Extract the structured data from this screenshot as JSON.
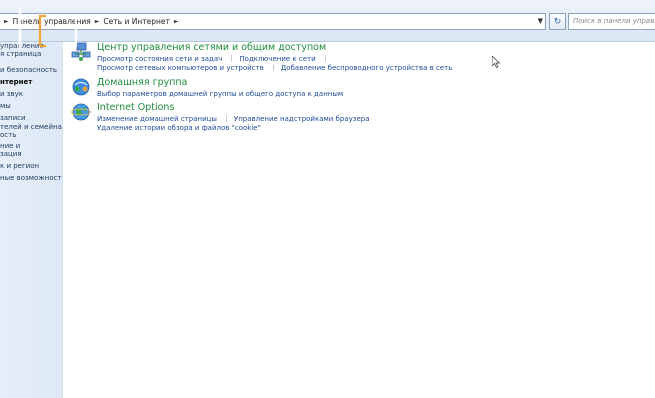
{
  "address": {
    "crumbs": [
      "Панель управления",
      "Сеть и Интернет"
    ],
    "search_placeholder": "Поиск в панели управления"
  },
  "leftpane": {
    "items": [
      "управления",
      "я страница",
      "и безопасность",
      "нтернет",
      "и звук",
      "мы",
      "записи",
      "телей и семейная",
      "ость",
      "ние и",
      "зация",
      "к и регион",
      "ные возможности"
    ]
  },
  "categories": [
    {
      "title": "Центр управления сетями и общим доступом",
      "rows": [
        [
          "Просмотр состояния сети и задач",
          "Подключение к сети"
        ],
        [
          "Просмотр сетевых компьютеров и устройств",
          "Добавление беспроводного устройства в сеть"
        ]
      ]
    },
    {
      "title": "Домашняя группа",
      "rows": [
        [
          "Выбор параметров домашней группы и общего доступа к данным"
        ]
      ]
    },
    {
      "title": "Internet Options",
      "rows": [
        [
          "Изменение домашней страницы",
          "Управление надстройками браузера"
        ],
        [
          "Удаление истории обзора и файлов \"cookie\""
        ]
      ]
    }
  ]
}
